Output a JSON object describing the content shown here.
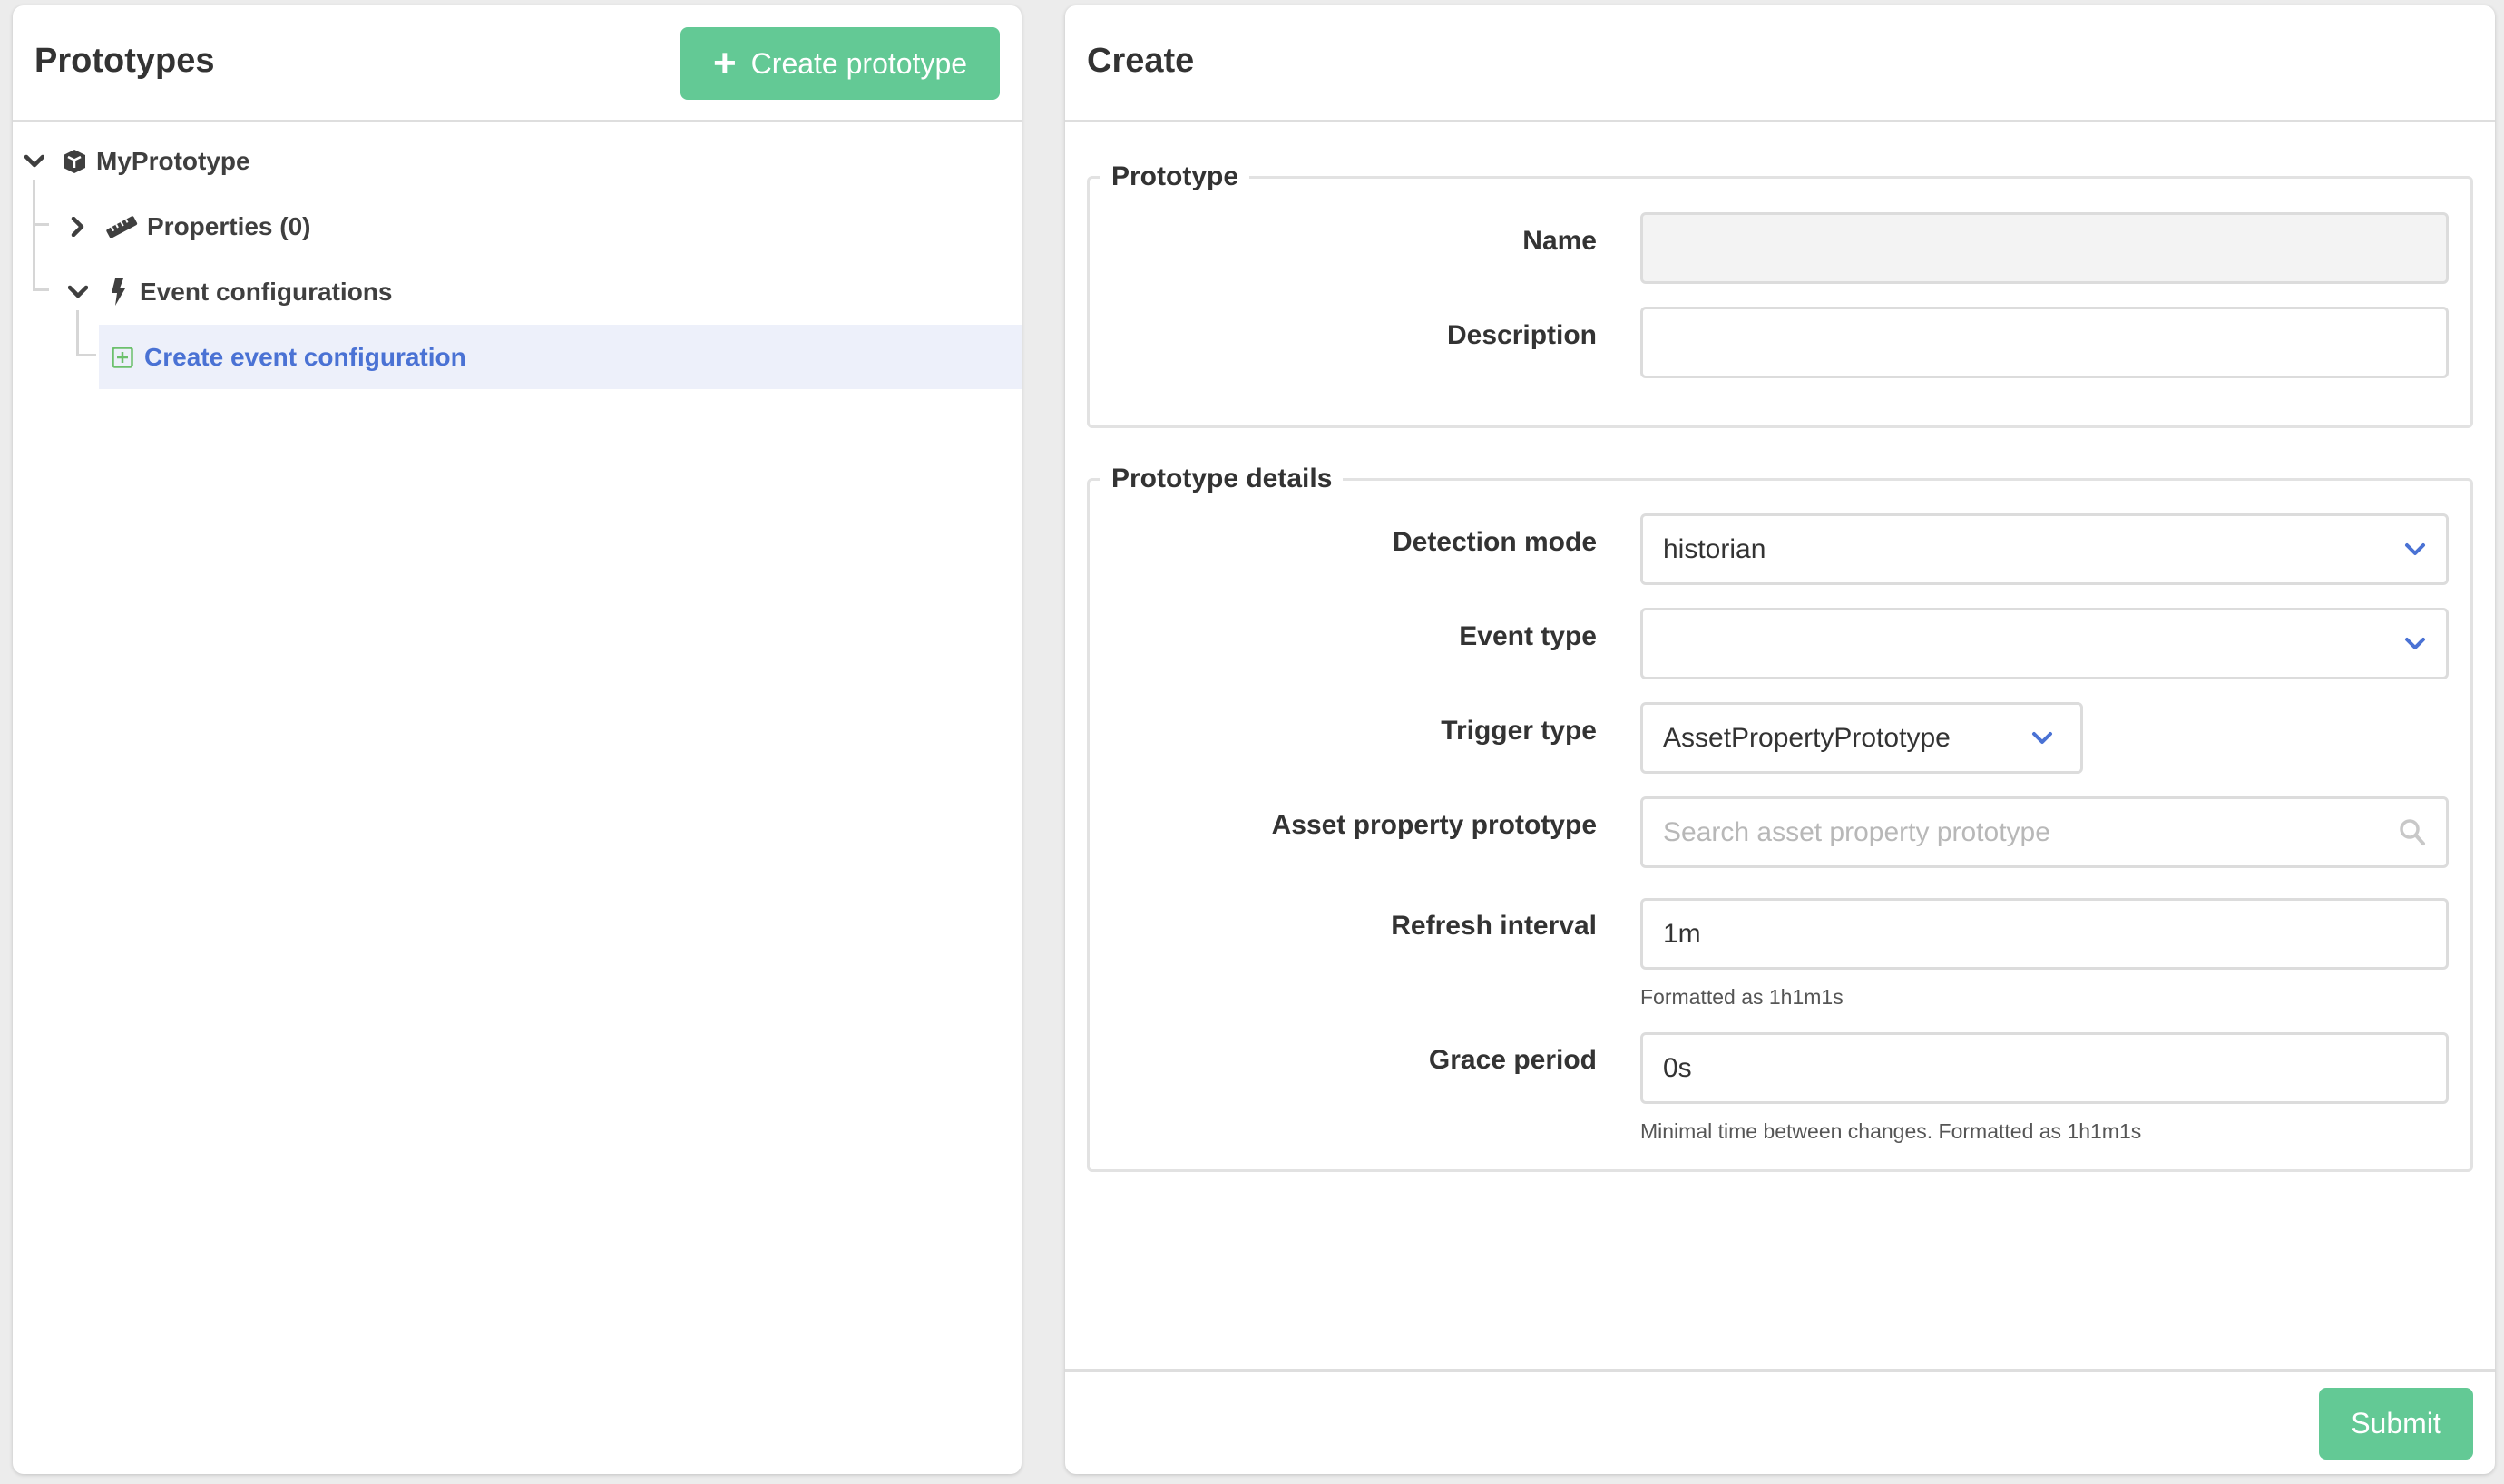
{
  "left_panel": {
    "title": "Prototypes",
    "create_button_label": "Create prototype",
    "tree": {
      "root": {
        "label": "MyPrototype",
        "expanded": true,
        "icon": "cube-icon"
      },
      "children": [
        {
          "label": "Properties (0)",
          "expanded": false,
          "icon": "ruler-icon"
        },
        {
          "label": "Event configurations",
          "expanded": true,
          "icon": "bolt-icon",
          "children": [
            {
              "label": "Create event configuration",
              "icon": "plus-square-icon",
              "selected": true
            }
          ]
        }
      ]
    }
  },
  "right_panel": {
    "title": "Create",
    "sections": {
      "prototype": {
        "legend": "Prototype",
        "name": {
          "label": "Name",
          "value": "",
          "disabled": true
        },
        "description": {
          "label": "Description",
          "value": ""
        }
      },
      "details": {
        "legend": "Prototype details",
        "detection_mode": {
          "label": "Detection mode",
          "value": "historian"
        },
        "event_type": {
          "label": "Event type",
          "value": ""
        },
        "trigger_type": {
          "label": "Trigger type",
          "value": "AssetPropertyPrototype"
        },
        "asset_property_prototype": {
          "label": "Asset property prototype",
          "placeholder": "Search asset property prototype",
          "value": ""
        },
        "refresh_interval": {
          "label": "Refresh interval",
          "value": "1m",
          "help": "Formatted as 1h1m1s"
        },
        "grace_period": {
          "label": "Grace period",
          "value": "0s",
          "help": "Minimal time between changes. Formatted as 1h1m1s"
        }
      }
    },
    "submit_label": "Submit"
  },
  "colors": {
    "accent_green": "#63c995",
    "link_blue": "#4a72d4",
    "selected_row_bg": "#edf0fa",
    "icon_green": "#6cc06c"
  }
}
